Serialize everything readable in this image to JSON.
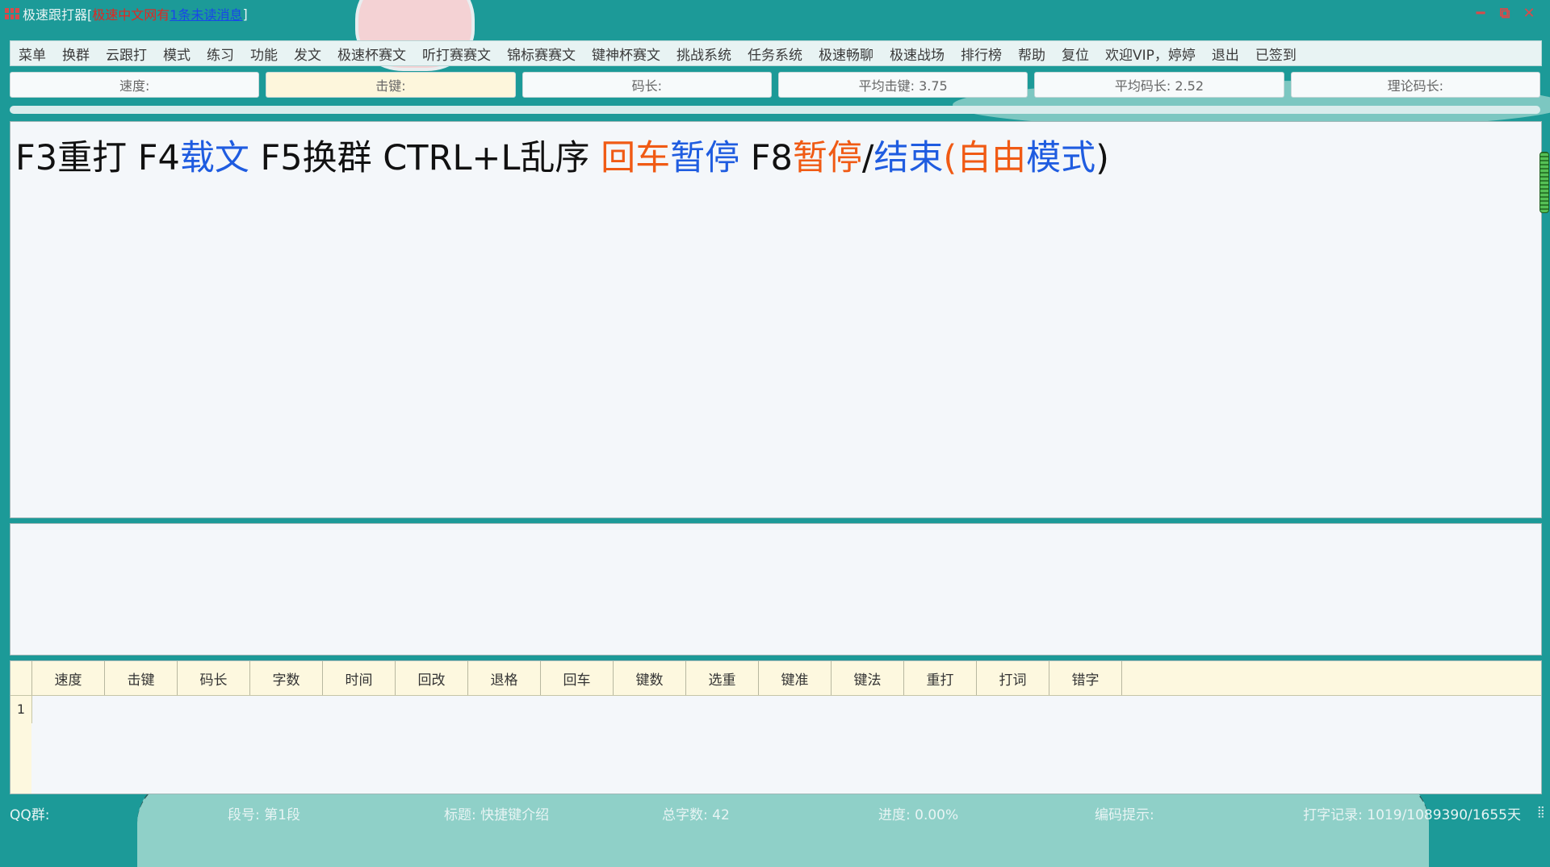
{
  "window": {
    "title_prefix": "极速跟打器[",
    "title_site": "极速中文网有",
    "title_messages": "1条未读消息",
    "title_suffix": "]",
    "minimize_label": "━",
    "restore_label": "⧉",
    "close_label": "✕"
  },
  "menu": [
    "菜单",
    "换群",
    "云跟打",
    "模式",
    "练习",
    "功能",
    "发文",
    "极速杯赛文",
    "听打赛赛文",
    "锦标赛赛文",
    "键神杯赛文",
    "挑战系统",
    "任务系统",
    "极速畅聊",
    "极速战场",
    "排行榜",
    "帮助",
    "复位",
    "欢迎VIP，婷婷",
    "退出",
    "已签到"
  ],
  "stats": {
    "speed": "速度:",
    "keystroke": "击键:",
    "code_length": "码长:",
    "avg_keystroke": "平均击键: 3.75",
    "avg_code_length": "平均码长: 2.52",
    "theory_code_length": "理论码长:"
  },
  "prompt": {
    "p1": "F3重打 F4",
    "p2": "载文",
    "p3": " F5换群 CTRL+L乱序 ",
    "p4": "回车",
    "p5": "暂停",
    "p6": " F8",
    "p7": "暂停",
    "p8": "/",
    "p9": "结束",
    "p10": "(",
    "p11": "自由",
    "p12": "模式",
    "p13": ")"
  },
  "table": {
    "headers": [
      "速度",
      "击键",
      "码长",
      "字数",
      "时间",
      "回改",
      "退格",
      "回车",
      "键数",
      "选重",
      "键准",
      "键法",
      "重打",
      "打词",
      "错字"
    ],
    "rows": [
      "1"
    ]
  },
  "status": {
    "qq": "QQ群:",
    "paragraph": "段号: 第1段",
    "caption": "标题: 快捷键介绍",
    "total_chars": "总字数: 42",
    "progress": "进度: 0.00%",
    "code_hint": "编码提示:",
    "record": "打字记录: 1019/1089390/1655天"
  }
}
